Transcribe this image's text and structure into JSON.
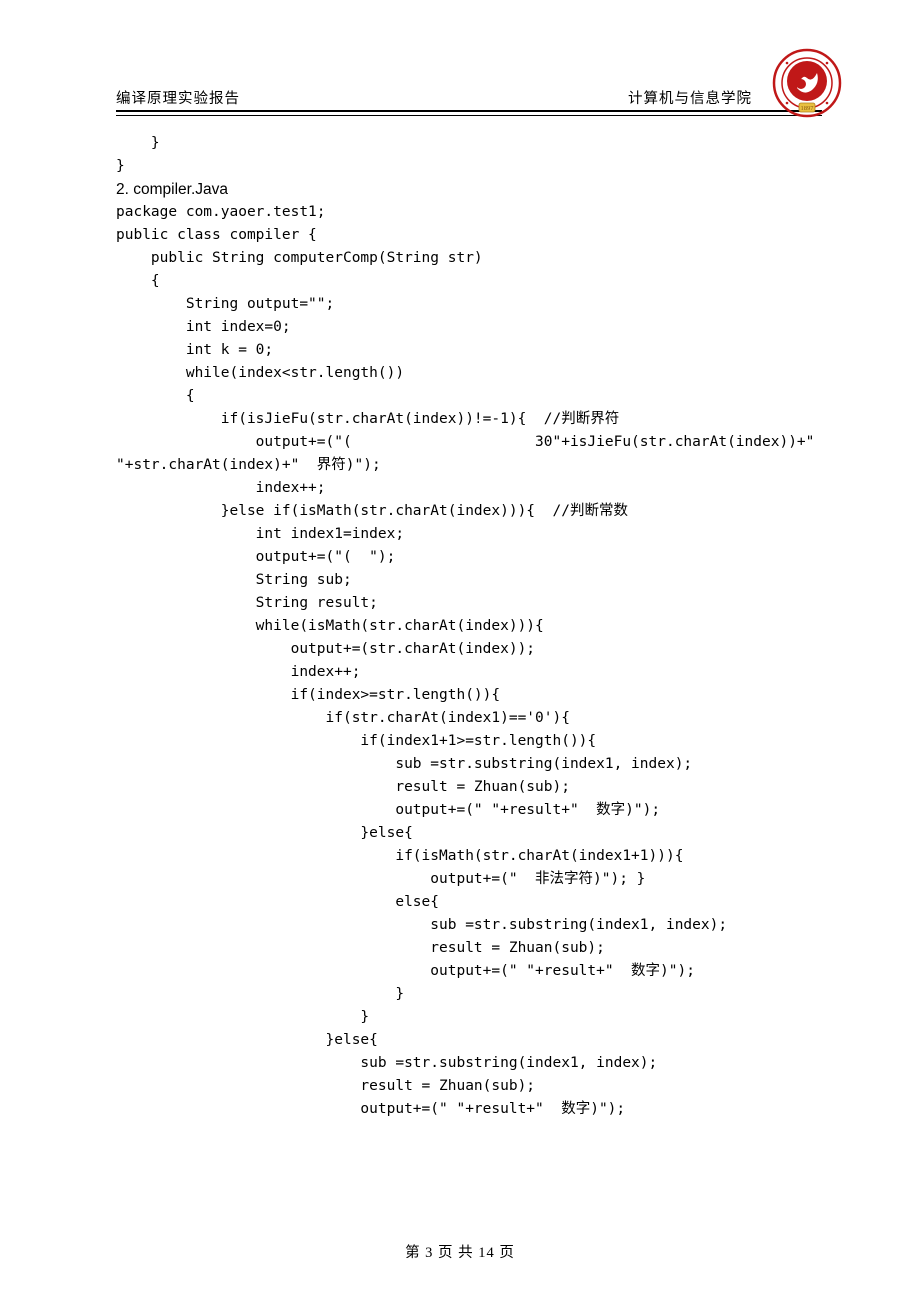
{
  "header": {
    "left": "编译原理实验报告",
    "right": "计算机与信息学院"
  },
  "logo": {
    "year": "1897"
  },
  "body": {
    "lines": [
      "    }",
      "}"
    ],
    "heading": "2. compiler.Java",
    "code": [
      "package com.yaoer.test1;",
      "public class compiler {",
      "    public String computerComp(String str)",
      "    {",
      "        String output=\"\";",
      "        int index=0;",
      "        int k = 0;",
      "        while(index<str.length())",
      "        {",
      "            if(isJieFu(str.charAt(index))!=-1){  //判断界符",
      "                output+=(\"(                     30\"+isJieFu(str.charAt(index))+\"",
      "\"+str.charAt(index)+\"  界符)\");",
      "                index++;",
      "            }else if(isMath(str.charAt(index))){  //判断常数",
      "                int index1=index;",
      "                output+=(\"(  \");",
      "                String sub;",
      "                String result;",
      "                while(isMath(str.charAt(index))){",
      "                    output+=(str.charAt(index));",
      "                    index++;",
      "                    if(index>=str.length()){",
      "                        if(str.charAt(index1)=='0'){",
      "                            if(index1+1>=str.length()){",
      "                                sub =str.substring(index1, index);",
      "                                result = Zhuan(sub);",
      "                                output+=(\" \"+result+\"  数字)\");",
      "                            }else{",
      "                                if(isMath(str.charAt(index1+1))){",
      "                                    output+=(\"  非法字符)\"); }",
      "                                else{",
      "                                    sub =str.substring(index1, index);",
      "                                    result = Zhuan(sub);",
      "                                    output+=(\" \"+result+\"  数字)\");",
      "                                }",
      "                            }",
      "",
      "                        }else{",
      "                            sub =str.substring(index1, index);",
      "                            result = Zhuan(sub);",
      "                            output+=(\" \"+result+\"  数字)\");"
    ]
  },
  "footer": {
    "text": "第 3 页 共 14 页"
  }
}
